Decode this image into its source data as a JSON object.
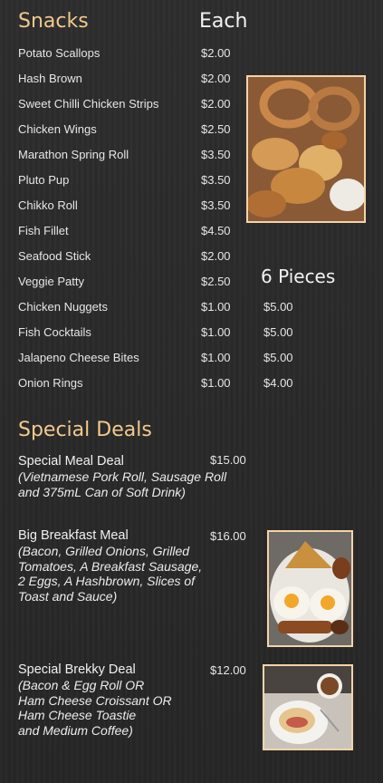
{
  "snacks": {
    "heading": "Snacks",
    "col_each": "Each",
    "col_six": "6 Pieces",
    "items": [
      {
        "name": "Potato Scallops",
        "each": "$2.00",
        "six": ""
      },
      {
        "name": "Hash Brown",
        "each": "$2.00",
        "six": ""
      },
      {
        "name": "Sweet Chilli Chicken Strips",
        "each": "$2.00",
        "six": ""
      },
      {
        "name": "Chicken Wings",
        "each": "$2.50",
        "six": ""
      },
      {
        "name": "Marathon Spring Roll",
        "each": "$3.50",
        "six": ""
      },
      {
        "name": "Pluto Pup",
        "each": "$3.50",
        "six": ""
      },
      {
        "name": "Chikko Roll",
        "each": "$3.50",
        "six": ""
      },
      {
        "name": "Fish Fillet",
        "each": "$4.50",
        "six": ""
      },
      {
        "name": "Seafood Stick",
        "each": "$2.00",
        "six": ""
      },
      {
        "name": "Veggie Patty",
        "each": "$2.50",
        "six": ""
      },
      {
        "name": "Chicken Nuggets",
        "each": "$1.00",
        "six": "$5.00"
      },
      {
        "name": "Fish Cocktails",
        "each": "$1.00",
        "six": "$5.00"
      },
      {
        "name": "Jalapeno Cheese Bites",
        "each": "$1.00",
        "six": "$5.00"
      },
      {
        "name": "Onion Rings",
        "each": "$1.00",
        "six": "$4.00"
      }
    ]
  },
  "deals": {
    "heading": "Special Deals",
    "items": [
      {
        "title": "Special Meal Deal",
        "price": "$15.00",
        "desc": "(Vietnamese Pork Roll, Sausage Roll\nand 375mL Can of Soft Drink)"
      },
      {
        "title": "Big Breakfast Meal",
        "price": "$16.00",
        "desc": "(Bacon, Grilled Onions, Grilled\nTomatoes, A Breakfast Sausage,\n2 Eggs, A Hashbrown, Slices of\nToast and Sauce)"
      },
      {
        "title": "Special Brekky Deal",
        "price": "$12.00",
        "desc": "(Bacon & Egg Roll  OR\nHam Cheese Croissant OR\nHam Cheese Toastie\nand Medium Coffee)"
      }
    ]
  },
  "colors": {
    "background": "#2a2a2a",
    "heading_gold": "#f2c98e",
    "photo_border": "#f3d4a8"
  },
  "photos": [
    "snacks-platter-photo",
    "big-breakfast-photo",
    "brekky-deal-photo"
  ]
}
